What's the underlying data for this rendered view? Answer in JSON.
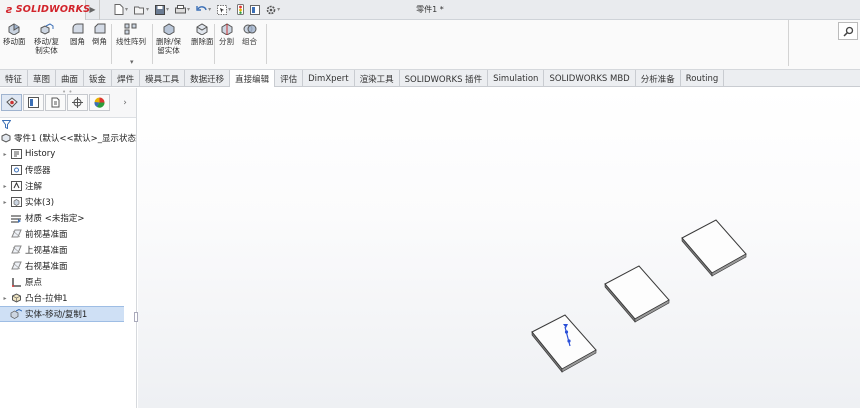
{
  "app": {
    "logo_text": "SOLIDWORKS",
    "document_title": "零件1 *"
  },
  "ribbon": {
    "buttons": [
      {
        "label": "移动面"
      },
      {
        "label": "移动/复\n制实体"
      },
      {
        "label": "圆角"
      },
      {
        "label": "倒角"
      },
      {
        "label": "线性阵列"
      },
      {
        "label": "删除/保\n留实体"
      },
      {
        "label": "删除面"
      },
      {
        "label": "分割"
      },
      {
        "label": "组合"
      }
    ]
  },
  "tabs": [
    {
      "label": "特征"
    },
    {
      "label": "草图"
    },
    {
      "label": "曲面"
    },
    {
      "label": "钣金"
    },
    {
      "label": "焊件"
    },
    {
      "label": "模具工具"
    },
    {
      "label": "数据迁移"
    },
    {
      "label": "直接编辑",
      "active": true
    },
    {
      "label": "评估"
    },
    {
      "label": "DimXpert"
    },
    {
      "label": "渲染工具"
    },
    {
      "label": "SOLIDWORKS 插件"
    },
    {
      "label": "Simulation"
    },
    {
      "label": "SOLIDWORKS MBD"
    },
    {
      "label": "分析准备"
    },
    {
      "label": "Routing"
    }
  ],
  "tree": {
    "root": "零件1 (默认<<默认>_显示状态",
    "items": [
      {
        "label": "History",
        "icon": "history-icon",
        "expandable": true
      },
      {
        "label": "传感器",
        "icon": "sensor-icon",
        "expandable": false
      },
      {
        "label": "注解",
        "icon": "annotation-icon",
        "expandable": true
      },
      {
        "label": "实体(3)",
        "icon": "solid-bodies-icon",
        "expandable": true
      },
      {
        "label": "材质 <未指定>",
        "icon": "material-icon",
        "expandable": false
      },
      {
        "label": "前视基准面",
        "icon": "plane-icon",
        "expandable": false
      },
      {
        "label": "上视基准面",
        "icon": "plane-icon",
        "expandable": false
      },
      {
        "label": "右视基准面",
        "icon": "plane-icon",
        "expandable": false
      },
      {
        "label": "原点",
        "icon": "origin-icon",
        "expandable": false
      },
      {
        "label": "凸台-拉伸1",
        "icon": "extrude-icon",
        "expandable": true
      },
      {
        "label": "实体-移动/复制1",
        "icon": "move-copy-icon",
        "expandable": false,
        "selected": true
      }
    ]
  },
  "colors": {
    "brand_red": "#d2232a",
    "selection": "#cfe0f5",
    "axis_blue": "#2a4fd8"
  }
}
